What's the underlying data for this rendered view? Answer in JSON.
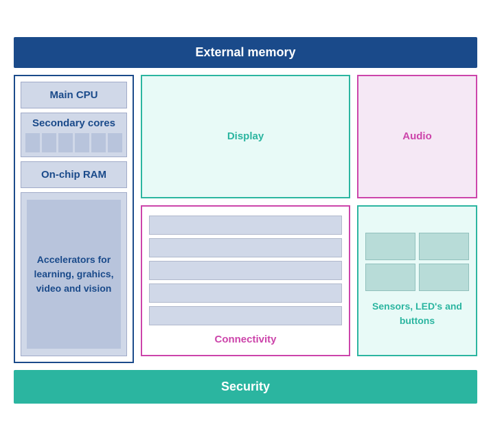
{
  "header": {
    "external_memory": "External memory"
  },
  "footer": {
    "security": "Security"
  },
  "left": {
    "display_label": "Display",
    "connectivity_label": "Connectivity"
  },
  "right": {
    "audio_label": "Audio",
    "sensors_label": "Sensors, LED's and buttons"
  },
  "center": {
    "main_cpu": "Main CPU",
    "secondary_cores": "Secondary cores",
    "on_chip_ram": "On-chip RAM",
    "accelerators": "Accelerators for learning, grahics, video and vision"
  }
}
